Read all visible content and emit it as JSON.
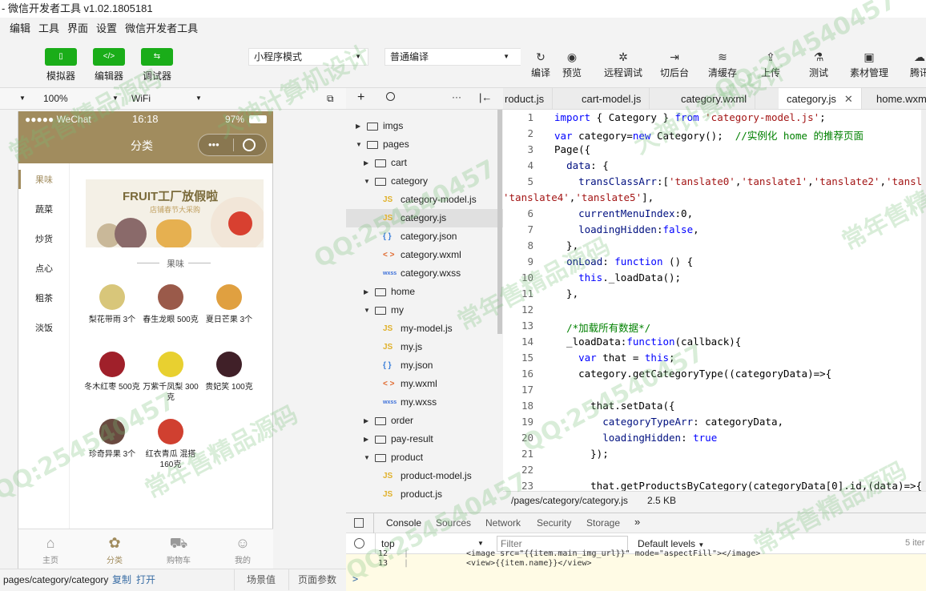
{
  "window": {
    "title": "- 微信开发者工具 v1.02.1805181"
  },
  "menu": [
    "编辑",
    "工具",
    "界面",
    "设置",
    "微信开发者工具"
  ],
  "modes": [
    {
      "label": "模拟器",
      "icon": "phone-icon",
      "glyph": "▯"
    },
    {
      "label": "编辑器",
      "icon": "code-icon",
      "glyph": "</>"
    },
    {
      "label": "调试器",
      "icon": "debug-icon",
      "glyph": "⇆"
    }
  ],
  "project_mode": {
    "value": "小程序模式"
  },
  "compile_mode": {
    "value": "普通编译"
  },
  "tools": [
    {
      "label": "编译",
      "icon": "refresh-icon",
      "glyph": "↻"
    },
    {
      "label": "预览",
      "icon": "eye-icon",
      "glyph": "◉"
    },
    {
      "label": "远程调试",
      "icon": "bug-icon",
      "glyph": "✲"
    },
    {
      "label": "切后台",
      "icon": "background-icon",
      "glyph": "⇥"
    },
    {
      "label": "清缓存",
      "icon": "layers-icon",
      "glyph": "≋"
    },
    {
      "label": "上传",
      "icon": "upload-icon",
      "glyph": "⇪"
    },
    {
      "label": "测试",
      "icon": "flask-icon",
      "glyph": "⚗"
    },
    {
      "label": "素材管理",
      "icon": "bookmark-icon",
      "glyph": "▣"
    },
    {
      "label": "腾讯",
      "icon": "cloud-icon",
      "glyph": "☁"
    }
  ],
  "simulator": {
    "zoom": "100%",
    "network": "WiFi",
    "status_left": "●●●●● WeChat",
    "time": "16:18",
    "battery": "97%",
    "nav_title": "分类",
    "categories": [
      "果味",
      "蔬菜",
      "炒货",
      "点心",
      "粗茶",
      "淡饭"
    ],
    "banner_title": "FRUIT工厂放假啦",
    "banner_sub": "店铺春节大采购",
    "section_title": "果味",
    "products": [
      {
        "name": "梨花带雨 3个",
        "color": "#d8c67a"
      },
      {
        "name": "春生龙眼 500克",
        "color": "#9a5a4a"
      },
      {
        "name": "夏日芒果 3个",
        "color": "#e0a040"
      },
      {
        "name": "冬木红枣 500克",
        "color": "#a0202a"
      },
      {
        "name": "万紫千凤梨 300克",
        "color": "#e8d030"
      },
      {
        "name": "贵妃笑 100克",
        "color": "#402028"
      },
      {
        "name": "珍奇异果 3个",
        "color": "#6a4a40"
      },
      {
        "name": "红衣青瓜 混搭 160克",
        "color": "#d04030"
      }
    ],
    "tabs": [
      {
        "label": "主页",
        "icon": "home-icon",
        "glyph": "⌂"
      },
      {
        "label": "分类",
        "icon": "category-icon",
        "glyph": "✿"
      },
      {
        "label": "购物车",
        "icon": "cart-icon",
        "glyph": "⛟"
      },
      {
        "label": "我的",
        "icon": "user-icon",
        "glyph": "☺"
      }
    ],
    "page_path": "pages/category/category",
    "copy_label": "复制",
    "open_label": "打开",
    "scene_label": "场景值",
    "page_params_label": "页面参数"
  },
  "file_tree": [
    {
      "name": "imgs",
      "type": "folder",
      "depth": 0,
      "open": false
    },
    {
      "name": "pages",
      "type": "folder",
      "depth": 0,
      "open": true
    },
    {
      "name": "cart",
      "type": "folder",
      "depth": 1,
      "open": false
    },
    {
      "name": "category",
      "type": "folder",
      "depth": 1,
      "open": true
    },
    {
      "name": "category-model.js",
      "type": "js",
      "tag": "JS",
      "depth": 2
    },
    {
      "name": "category.js",
      "type": "js",
      "tag": "JS",
      "depth": 2,
      "selected": true
    },
    {
      "name": "category.json",
      "type": "json",
      "tag": "{ }",
      "depth": 2
    },
    {
      "name": "category.wxml",
      "type": "wxml",
      "tag": "< >",
      "depth": 2
    },
    {
      "name": "category.wxss",
      "type": "wxss",
      "tag": "wxss",
      "depth": 2
    },
    {
      "name": "home",
      "type": "folder",
      "depth": 1,
      "open": false
    },
    {
      "name": "my",
      "type": "folder",
      "depth": 1,
      "open": true
    },
    {
      "name": "my-model.js",
      "type": "js",
      "tag": "JS",
      "depth": 2
    },
    {
      "name": "my.js",
      "type": "js",
      "tag": "JS",
      "depth": 2
    },
    {
      "name": "my.json",
      "type": "json",
      "tag": "{ }",
      "depth": 2
    },
    {
      "name": "my.wxml",
      "type": "wxml",
      "tag": "< >",
      "depth": 2
    },
    {
      "name": "my.wxss",
      "type": "wxss",
      "tag": "wxss",
      "depth": 2
    },
    {
      "name": "order",
      "type": "folder",
      "depth": 1,
      "open": false
    },
    {
      "name": "pay-result",
      "type": "folder",
      "depth": 1,
      "open": false
    },
    {
      "name": "product",
      "type": "folder",
      "depth": 1,
      "open": true
    },
    {
      "name": "product-model.js",
      "type": "js",
      "tag": "JS",
      "depth": 2
    },
    {
      "name": "product.js",
      "type": "js",
      "tag": "JS",
      "depth": 2
    }
  ],
  "editor_tabs": [
    {
      "label": "roduct.js",
      "active": false
    },
    {
      "label": "cart-model.js",
      "active": false
    },
    {
      "label": "category.wxml",
      "active": false
    },
    {
      "label": "category.js",
      "active": true
    },
    {
      "label": "home.wxm",
      "active": false
    }
  ],
  "code_lines": [
    {
      "n": "1",
      "html": "<span class=\"kw\">import</span> { Category } <span class=\"kw\">from</span> <span class=\"str\">'category-model.js'</span>;"
    },
    {
      "n": "2",
      "html": "<span class=\"kw\">var</span> category=<span class=\"kw\">new</span> Category();  <span class=\"cm\">//实例化 home 的推荐页面</span>"
    },
    {
      "n": "3",
      "html": "Page({"
    },
    {
      "n": "4",
      "html": "  <span class=\"prop\">data</span>: {"
    },
    {
      "n": "5",
      "html": "    <span class=\"prop\">transClassArr</span>:[<span class=\"str\">'tanslate0'</span>,<span class=\"str\">'tanslate1'</span>,<span class=\"str\">'tanslate2'</span>,<span class=\"str\">'tansl</span>"
    },
    {
      "n": "",
      "html": "<span class=\"str\">'tanslate4'</span>,<span class=\"str\">'tanslate5'</span>],",
      "wrap": true
    },
    {
      "n": "6",
      "html": "    <span class=\"prop\">currentMenuIndex</span>:0,"
    },
    {
      "n": "7",
      "html": "    <span class=\"prop\">loadingHidden</span>:<span class=\"val\">false</span>,"
    },
    {
      "n": "8",
      "html": "  },"
    },
    {
      "n": "9",
      "html": "  <span class=\"prop\">onLoad</span>: <span class=\"kw\">function</span> () {"
    },
    {
      "n": "10",
      "html": "    <span class=\"kw\">this</span>._loadData();"
    },
    {
      "n": "11",
      "html": "  },"
    },
    {
      "n": "12",
      "html": ""
    },
    {
      "n": "13",
      "html": "  <span class=\"cm\">/*加载所有数据*/</span>"
    },
    {
      "n": "14",
      "html": "  _loadData:<span class=\"kw\">function</span>(callback){"
    },
    {
      "n": "15",
      "html": "    <span class=\"kw\">var</span> that = <span class=\"kw\">this</span>;"
    },
    {
      "n": "16",
      "html": "    category.getCategoryType((categoryData)=>{"
    },
    {
      "n": "17",
      "html": ""
    },
    {
      "n": "18",
      "html": "      that.setData({"
    },
    {
      "n": "19",
      "html": "        <span class=\"prop\">categoryTypeArr</span>: categoryData,"
    },
    {
      "n": "20",
      "html": "        <span class=\"prop\">loadingHidden</span>: <span class=\"val\">true</span>"
    },
    {
      "n": "21",
      "html": "      });"
    },
    {
      "n": "22",
      "html": ""
    },
    {
      "n": "23",
      "html": "      that.getProductsByCategory(categoryData[0].id,(data)=>{"
    }
  ],
  "editor_status": {
    "path": "/pages/category/category.js",
    "size": "2.5 KB"
  },
  "console": {
    "tabs": [
      "Console",
      "Sources",
      "Network",
      "Security",
      "Storage"
    ],
    "context": "top",
    "filter_placeholder": "Filter",
    "levels": "Default levels",
    "count": "5 iter",
    "lines": [
      {
        "n": "12",
        "text": "<image src=\"{{item.main_img_url}}\" mode=\"aspectFill\"></image>"
      },
      {
        "n": "13",
        "text": "<view>{{item.name}}</view>"
      }
    ],
    "prompt": ">"
  },
  "watermark": [
    "大神计算机设计",
    "QQ:254540457",
    "常年售精品源码"
  ]
}
